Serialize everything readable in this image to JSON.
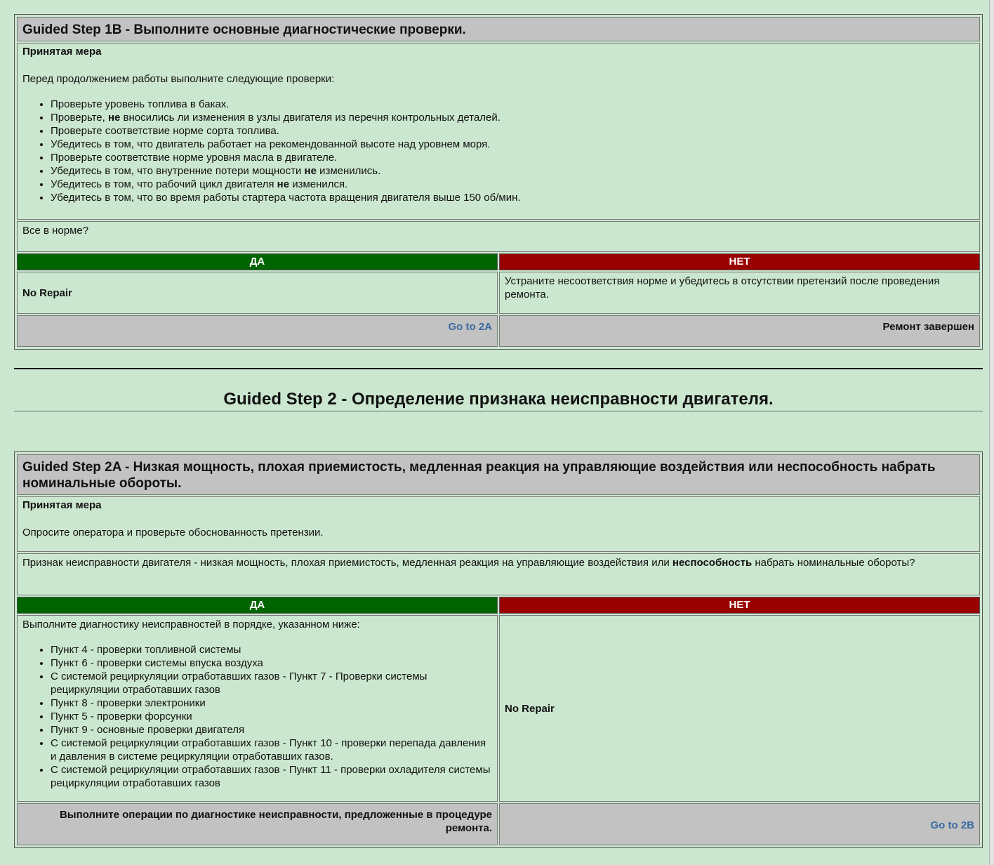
{
  "step1b": {
    "title": "Guided Step 1B - Выполните основные диагностические проверки.",
    "action_heading": "Принятая мера",
    "intro": "Перед продолжением работы выполните следующие проверки:",
    "checks": [
      [
        "Проверьте уровень топлива в баках."
      ],
      [
        "Проверьте, ",
        "не",
        " вносились ли изменения в узлы двигателя из перечня контрольных деталей."
      ],
      [
        "Проверьте соответствие норме сорта топлива."
      ],
      [
        "Убедитесь в том, что двигатель работает на рекомендованной высоте над уровнем моря."
      ],
      [
        "Проверьте соответствие норме уровня масла в двигателе."
      ],
      [
        "Убедитесь в том, что внутренние потери мощности ",
        "не",
        " изменились."
      ],
      [
        "Убедитесь в том, что рабочий цикл двигателя ",
        "не",
        " изменился."
      ],
      [
        "Убедитесь в том, что во время работы стартера частота вращения двигателя выше 150 об/мин."
      ]
    ],
    "question": "Все в норме?",
    "yes_label": "ДА",
    "no_label": "НЕТ",
    "yes_result": "No Repair",
    "no_result": "Устраните несоответствия норме и убедитесь в отсутствии претензий после проведения ремонта.",
    "yes_nav": "Go to 2A",
    "no_nav": "Ремонт завершен"
  },
  "step2_heading": "Guided Step 2 - Определение признака неисправности двигателя.",
  "step2a": {
    "title": "Guided Step 2A - Низкая мощность, плохая приемистость, медленная реакция на управляющие воздействия или неспособность набрать номинальные обороты.",
    "action_heading": "Принятая мера",
    "intro": "Опросите оператора и проверьте обоснованность претензии.",
    "question_parts": [
      "Признак неисправности двигателя - низкая мощность, плохая приемистость, медленная реакция на управляющие воздействия или ",
      "неспособность",
      " набрать номинальные обороты?"
    ],
    "yes_label": "ДА",
    "no_label": "НЕТ",
    "yes_intro": "Выполните диагностику неисправностей в порядке, указанном ниже:",
    "procedures": [
      "Пункт 4 - проверки топливной системы",
      "Пункт 6 - проверки системы впуска воздуха",
      "С системой рециркуляции отработавших газов - Пункт 7 - Проверки системы рециркуляции отработавших газов",
      "Пункт 8 - проверки электроники",
      "Пункт 5 - проверки форсунки",
      "Пункт 9 - основные проверки двигателя",
      "С системой рециркуляции отработавших газов - Пункт 10 - проверки перепада давления и давления в системе рециркуляции отработавших газов.",
      "С системой рециркуляции отработавших газов - Пункт 11 - проверки охладителя системы рециркуляции отработавших газов"
    ],
    "no_result": "No Repair",
    "yes_nav": "Выполните операции по диагностике неисправности, предложенные в процедуре ремонта.",
    "no_nav": "Go to 2B"
  },
  "colors": {
    "background": "#cbe7cf",
    "header_gray": "#c2c2c2",
    "yes_green": "#006400",
    "no_red": "#990000",
    "link_blue": "#3a6aa0"
  }
}
